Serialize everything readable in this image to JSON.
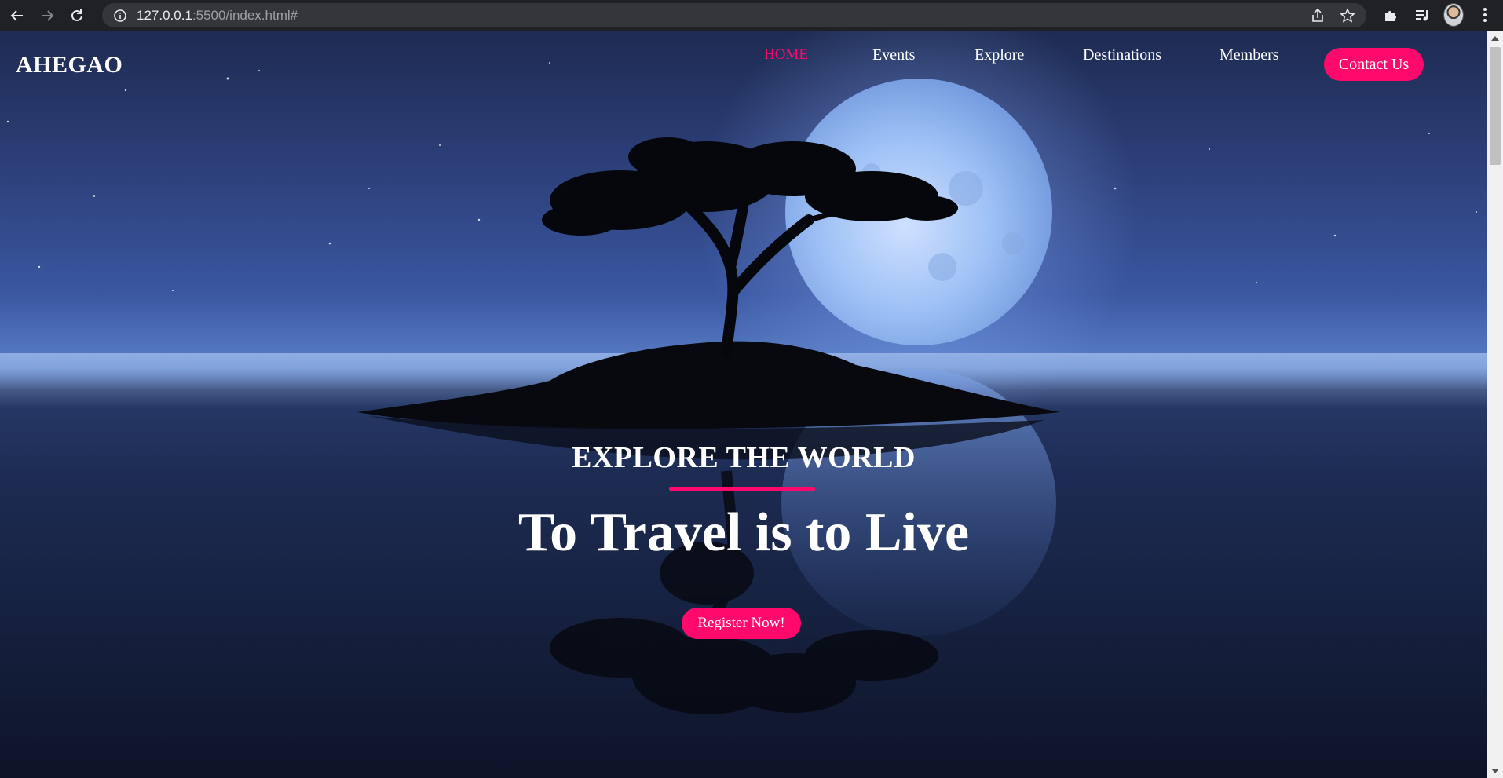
{
  "browser": {
    "url_host": "127.0.0.1",
    "url_rest": ":5500/index.html#",
    "icons": {
      "back": "back-arrow-icon",
      "forward": "forward-arrow-icon",
      "reload": "reload-icon",
      "info": "info-icon",
      "share": "share-icon",
      "bookmark": "star-icon",
      "extensions": "puzzle-icon",
      "media": "media-queue-icon",
      "profile": "avatar",
      "menu": "kebab-menu-icon"
    }
  },
  "site": {
    "logo": "AHEGAO",
    "nav": {
      "home": "HOME",
      "events": "Events",
      "explore": "Explore",
      "destinations": "Destinations",
      "members": "Members"
    },
    "contact_label": "Contact Us",
    "hero": {
      "subtitle": "EXPLORE THE WORLD",
      "title": "To Travel is to Live",
      "register_label": "Register Now!"
    }
  },
  "colors": {
    "accent": "#ff0a6c",
    "chrome_bg": "#202124",
    "omnibox_bg": "#35363a",
    "sky_top": "#1e2b52",
    "sky_horizon": "#5a7fc8",
    "water_bottom": "#0e1428"
  }
}
